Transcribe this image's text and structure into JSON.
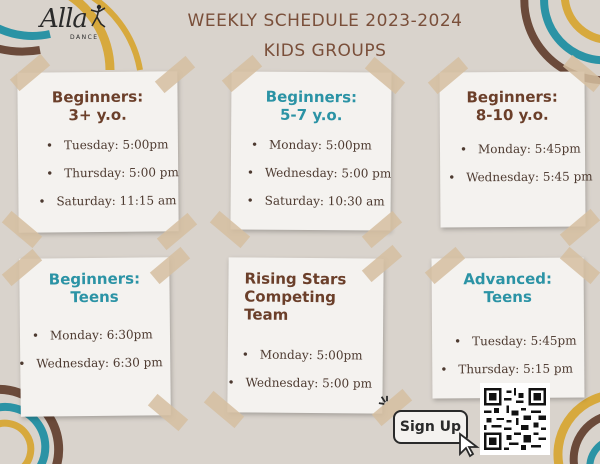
{
  "logo": {
    "script": "Alla",
    "sub": "DANCE"
  },
  "title": {
    "line1": "WEEKLY SCHEDULE 2023-2024",
    "line2": "KIDS GROUPS"
  },
  "cards": [
    {
      "title": "Beginners:\n3+ y.o.",
      "color": "#6b3f2a",
      "items": [
        "Tuesday: 5:00pm",
        "Thursday: 5:00 pm",
        "Saturday: 11:15 am"
      ]
    },
    {
      "title": "Beginners:\n5-7 y.o.",
      "color": "#2b93a5",
      "items": [
        "Monday: 5:00pm",
        "Wednesday: 5:00 pm",
        "Saturday: 10:30 am"
      ]
    },
    {
      "title": "Beginners:\n8-10 y.o.",
      "color": "#6b3f2a",
      "items": [
        "Monday: 5:45pm",
        "Wednesday: 5:45 pm"
      ]
    },
    {
      "title": "Beginners:\nTeens",
      "color": "#2b93a5",
      "items": [
        "Monday: 6:30pm",
        "Wednesday: 6:30 pm"
      ]
    },
    {
      "title": "Rising Stars\nCompeting\nTeam",
      "color": "#6b3f2a",
      "items": [
        "Monday: 5:00pm",
        "Wednesday: 5:00 pm"
      ]
    },
    {
      "title": "Advanced:\nTeens",
      "color": "#2b93a5",
      "items": [
        "Tuesday: 5:45pm",
        "Thursday: 5:15 pm"
      ]
    }
  ],
  "signup": {
    "label": "Sign Up"
  },
  "colors": {
    "background": "#d9d3cc",
    "brown": "#6b3f2a",
    "teal": "#2b93a5",
    "gold": "#d7a93d"
  }
}
